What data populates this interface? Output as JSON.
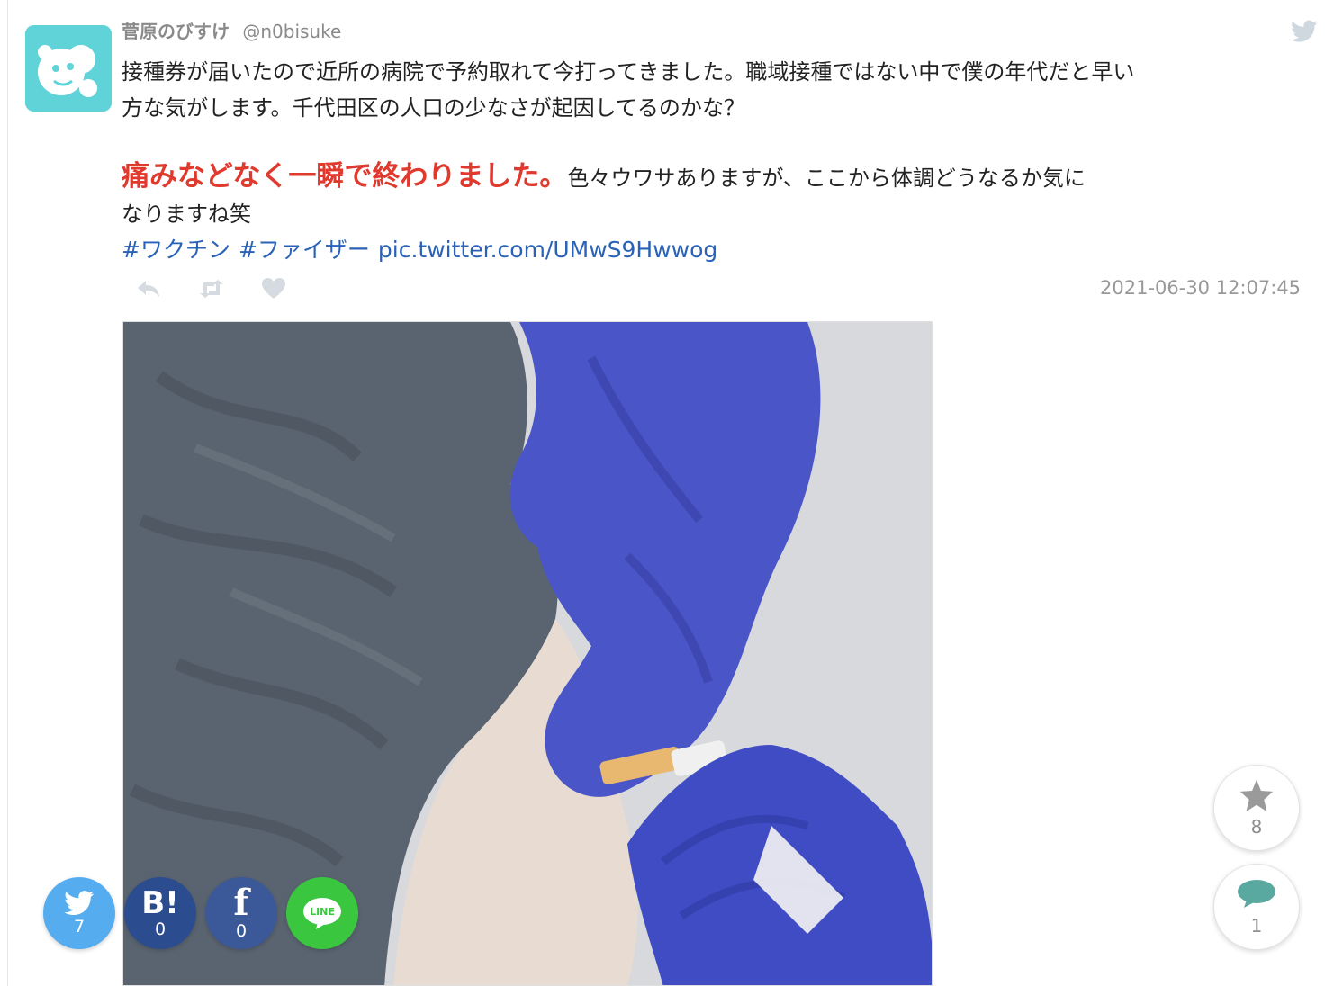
{
  "tweet": {
    "author_name": "菅原のびすけ",
    "author_handle": "@n0bisuke",
    "text_line1": "接種券が届いたので近所の病院で予約取れて今打ってきました。職域接種ではない中で僕の年代だと早い",
    "text_line2": "方な気がします。千代田区の人口の少なさが起因してるのかな？",
    "highlight_text": "痛みなどなく一瞬で終わりました。",
    "text_line3_rest": "色々ウワサありますが、ここから体調どうなるか気に",
    "text_line4": "なりますね笑",
    "hashtag1": "#ワクチン",
    "hashtag2": "#ファイザー",
    "link": "pic.twitter.com/UMwS9Hwwog",
    "timestamp": "2021-06-30 12:07:45"
  },
  "share": {
    "twitter_count": "7",
    "hatena_label": "B!",
    "hatena_count": "0",
    "facebook_label": "f",
    "facebook_count": "0",
    "line_label": "LINE"
  },
  "floating": {
    "favorite_count": "8",
    "comment_count": "1"
  },
  "colors": {
    "highlight": "#e03a2f",
    "link": "#2a62b8",
    "twitter": "#55acee",
    "hatena": "#2b4c8f",
    "facebook": "#3b5998",
    "line": "#3ac63f",
    "comment_icon": "#5aa9a0"
  },
  "icons": {
    "reply": "reply-icon",
    "retweet": "retweet-icon",
    "like": "heart-icon",
    "corner": "twitter-bird-icon",
    "favorite": "star-icon",
    "comment": "speech-bubble-icon"
  }
}
